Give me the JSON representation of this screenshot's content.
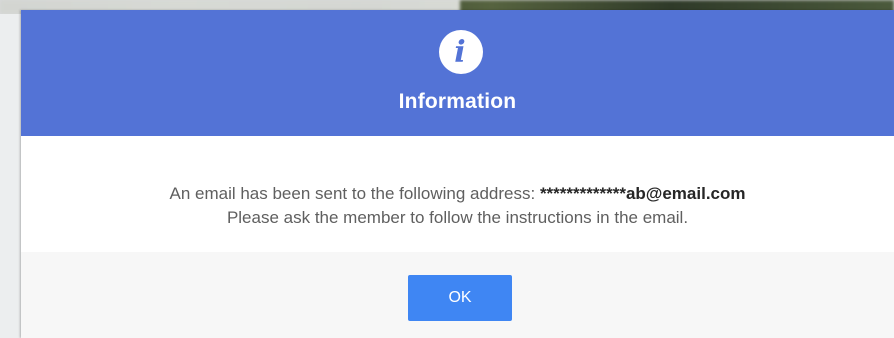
{
  "dialog": {
    "title": "Information",
    "icon": "info-icon",
    "message_prefix": "An email has been sent to the following address: ",
    "email": "*************ab@email.com",
    "message_line2": "Please ask the member to follow the instructions in the email.",
    "ok_label": "OK"
  },
  "colors": {
    "header": "#5373d6",
    "button": "#3f86f3",
    "footer": "#f7f7f7"
  }
}
